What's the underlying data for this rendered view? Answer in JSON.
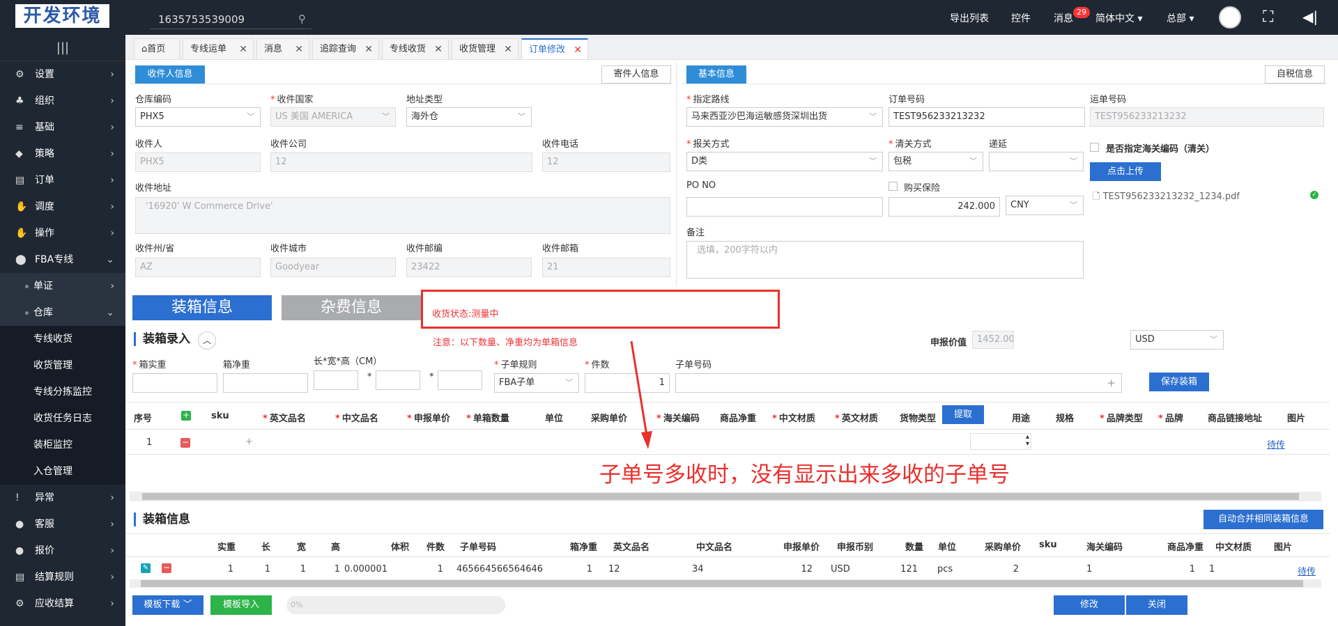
{
  "header": {
    "logo": "开发环境",
    "search_value": "1635753539009",
    "export_list": "导出列表",
    "controls": "控件",
    "messages": "消息",
    "message_count": "29",
    "language": "简体中文",
    "department": "总部"
  },
  "sidebar": {
    "items": [
      {
        "label": "设置",
        "icon": "⚙"
      },
      {
        "label": "组织",
        "icon": "♣"
      },
      {
        "label": "基础",
        "icon": "≡"
      },
      {
        "label": "策略",
        "icon": "◆"
      },
      {
        "label": "订单",
        "icon": "▤"
      },
      {
        "label": "调度",
        "icon": "✋"
      },
      {
        "label": "操作",
        "icon": "✋"
      },
      {
        "label": "FBA专线",
        "icon": "⬤"
      }
    ],
    "sub_items": [
      {
        "label": "单证"
      },
      {
        "label": "仓库"
      }
    ],
    "leaf_items": [
      "专线收货",
      "收货管理",
      "专线分拣监控",
      "收货任务日志",
      "装柜监控",
      "入仓管理"
    ],
    "bottom_items": [
      {
        "label": "异常",
        "icon": "!"
      },
      {
        "label": "客服",
        "icon": "●"
      },
      {
        "label": "报价",
        "icon": "●"
      },
      {
        "label": "结算规则",
        "icon": "▤"
      },
      {
        "label": "应收结算",
        "icon": "⚙"
      }
    ]
  },
  "tabs": [
    {
      "label": "首页"
    },
    {
      "label": "专线运单"
    },
    {
      "label": "消息"
    },
    {
      "label": "追踪查询"
    },
    {
      "label": "专线收货"
    },
    {
      "label": "收货管理"
    },
    {
      "label": "订单修改"
    }
  ],
  "receiver": {
    "tab_active": "收件人信息",
    "tab_other": "寄件人信息",
    "warehouse_code_label": "仓库编码",
    "warehouse_code": "PHX5",
    "country_label": "收件国家",
    "country": "US 美国 AMERICA",
    "address_type_label": "地址类型",
    "address_type": "海外仓",
    "name_label": "收件人",
    "name": "PHX5",
    "company_label": "收件公司",
    "company": "12",
    "phone_label": "收件电话",
    "phone": "12",
    "address_label": "收件地址",
    "address": "'16920' W Commerce Drive'",
    "state_label": "收件州/省",
    "state": "AZ",
    "city_label": "收件城市",
    "city": "Goodyear",
    "zip_label": "收件邮编",
    "zip": "23422",
    "email_label": "收件邮箱",
    "email": "21"
  },
  "basic": {
    "tab_active": "基本信息",
    "tab_other": "自税信息",
    "route_label": "指定路线",
    "route": "马来西亚沙巴海运敏感货深圳出货",
    "order_no_label": "订单号码",
    "order_no": "TEST956233213232",
    "waybill_label": "运单号码",
    "waybill": "TEST956233213232",
    "customs_method_label": "报关方式",
    "customs_method": "D类",
    "clearance_label": "清关方式",
    "clearance": "包税",
    "delay_label": "递延",
    "delay": "",
    "hs_specify_label": "是否指定海关编码（清关）",
    "upload_button": "点击上传",
    "file_name": "TEST956233213232_1234.pdf",
    "po_label": "PO NO",
    "po": "",
    "insurance_label": "购买保险",
    "insurance_amount": "242.000",
    "currency": "CNY",
    "remark_label": "备注",
    "remark_placeholder": "选填，200字符以内"
  },
  "section_tabs": {
    "packing": "装箱信息",
    "misc": "杂费信息"
  },
  "annotation": {
    "status": "收货状态:测量中",
    "caption": "子单号多收时，没有显示出来多收的子单号"
  },
  "packing_entry": {
    "title": "装箱录入",
    "note": "注意：以下数量、净重均为单箱信息",
    "declared_value_label": "申报价值",
    "declared_value": "1452.00",
    "declared_currency": "USD",
    "gross_label": "箱实重",
    "net_label": "箱净重",
    "dims_label": "长*宽*高（CM）",
    "sub_rule_label": "子单规则",
    "sub_rule": "FBA子单",
    "pieces_label": "件数",
    "pieces": "1",
    "sub_no_label": "子单号码",
    "save_button": "保存装箱",
    "columns": [
      "序号",
      "sku",
      "英文品名",
      "中文品名",
      "申报单价",
      "单箱数量",
      "单位",
      "采购单价",
      "海关编码",
      "商品净重",
      "中文材质",
      "英文材质",
      "货物类型",
      "用途",
      "规格",
      "品牌类型",
      "品牌",
      "商品链接地址",
      "图片"
    ],
    "extract_button": "提取",
    "row": {
      "index": "1",
      "picture": "待传"
    }
  },
  "packing_info": {
    "title": "装箱信息",
    "merge_button": "自动合并相同装箱信息",
    "columns": [
      "实重",
      "长",
      "宽",
      "高",
      "体积",
      "件数",
      "子单号码",
      "箱净重",
      "英文品名",
      "中文品名",
      "申报单价",
      "申报币别",
      "数量",
      "单位",
      "采购单价",
      "sku",
      "海关编码",
      "商品净重",
      "中文材质",
      "图片"
    ],
    "row": [
      "1",
      "1",
      "1",
      "1",
      "0.000001",
      "1",
      "465664566564646",
      "1",
      "12",
      "34",
      "12",
      "USD",
      "121",
      "pcs",
      "2",
      "",
      "1",
      "1",
      "1",
      "待传"
    ]
  },
  "footer": {
    "template_download": "模板下载",
    "template_import": "模板导入",
    "progress": "0%",
    "modify": "修改",
    "close": "关闭"
  }
}
